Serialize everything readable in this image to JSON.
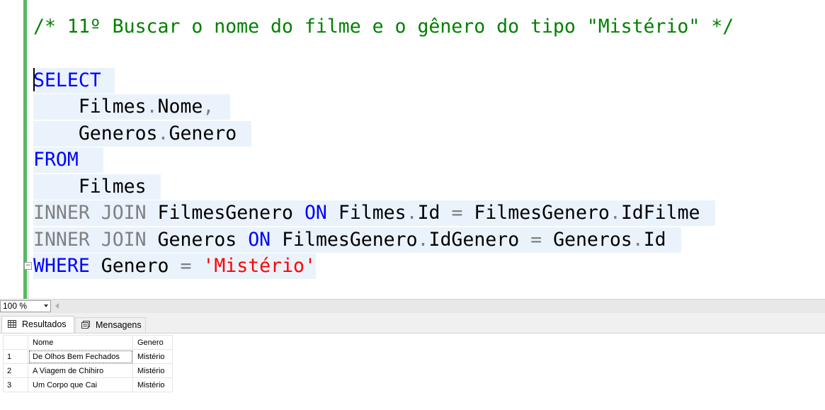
{
  "editor": {
    "comment": "/* 11º Buscar o nome do filme e o gênero do tipo \"Mistério\" */",
    "select_kw": "SELECT",
    "col1_table": "Filmes",
    "col1_field": "Nome",
    "comma": ",",
    "dot": ".",
    "col2_table": "Generos",
    "col2_field": "Genero",
    "from_kw": "FROM",
    "from_table": "Filmes",
    "inner": "INNER",
    "join": "JOIN",
    "on": "ON",
    "eq": "=",
    "join1_table": "FilmesGenero",
    "join1_left_table": "Filmes",
    "join1_left_field": "Id",
    "join1_right_table": "FilmesGenero",
    "join1_right_field": "IdFilme",
    "join2_table": "Generos",
    "join2_left_table": "FilmesGenero",
    "join2_left_field": "IdGenero",
    "join2_right_table": "Generos",
    "join2_right_field": "Id",
    "where_kw": "WHERE",
    "where_field": "Genero",
    "where_value": "'Mistério'",
    "collapse_glyph": "−"
  },
  "zoom": {
    "value": "100 %"
  },
  "tabs": {
    "results": "Resultados",
    "messages": "Mensagens"
  },
  "grid": {
    "columns": [
      "Nome",
      "Genero"
    ],
    "rows": [
      {
        "num": "1",
        "nome": "De Olhos Bem Fechados",
        "genero": "Mistério"
      },
      {
        "num": "2",
        "nome": "A Viagem de Chihiro",
        "genero": "Mistério"
      },
      {
        "num": "3",
        "nome": "Um Corpo que Cai",
        "genero": "Mistério"
      }
    ]
  },
  "colors": {
    "keyword": "#0000ff",
    "operator": "#808080",
    "string": "#ff0000",
    "comment": "#008000",
    "gutter": "#57b95e",
    "selection": "#eaf3fb"
  }
}
